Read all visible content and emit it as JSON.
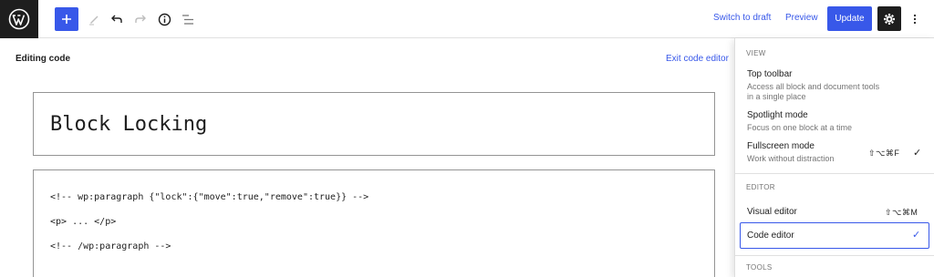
{
  "toolbar": {
    "switch_to_draft": "Switch to draft",
    "preview": "Preview",
    "update": "Update"
  },
  "editor": {
    "editing_label": "Editing code",
    "exit_code_editor": "Exit code editor",
    "title": "Block Locking",
    "code_lines": [
      "<!-- wp:paragraph {\"lock\":{\"move\":true,\"remove\":true}} -->",
      "<p> ... </p>",
      "<!-- /wp:paragraph -->"
    ]
  },
  "menu": {
    "view_label": "VIEW",
    "top_toolbar": {
      "title": "Top toolbar",
      "desc1": "Access all block and document tools",
      "desc2": "in a single place"
    },
    "spotlight": {
      "title": "Spotlight mode",
      "desc": "Focus on one block at a time"
    },
    "fullscreen": {
      "title": "Fullscreen mode",
      "desc": "Work without distraction",
      "shortcut": "⇧⌥⌘F",
      "checked": true
    },
    "editor_label": "EDITOR",
    "visual_editor": {
      "title": "Visual editor",
      "shortcut": "⇧⌥⌘M"
    },
    "code_editor": {
      "title": "Code editor",
      "checked": true
    },
    "tools_label": "TOOLS"
  },
  "colors": {
    "accent": "#3858e9",
    "dark": "#1e1e1e",
    "muted": "#757575"
  },
  "icons": {
    "logo": "wordpress-logo-icon",
    "add": "plus-icon",
    "tools": "pencil-icon",
    "undo": "undo-icon",
    "redo": "redo-icon",
    "details": "info-icon",
    "list_view": "list-view-icon",
    "settings": "gear-icon",
    "options": "more-vertical-icon",
    "check": "checkmark-icon"
  }
}
